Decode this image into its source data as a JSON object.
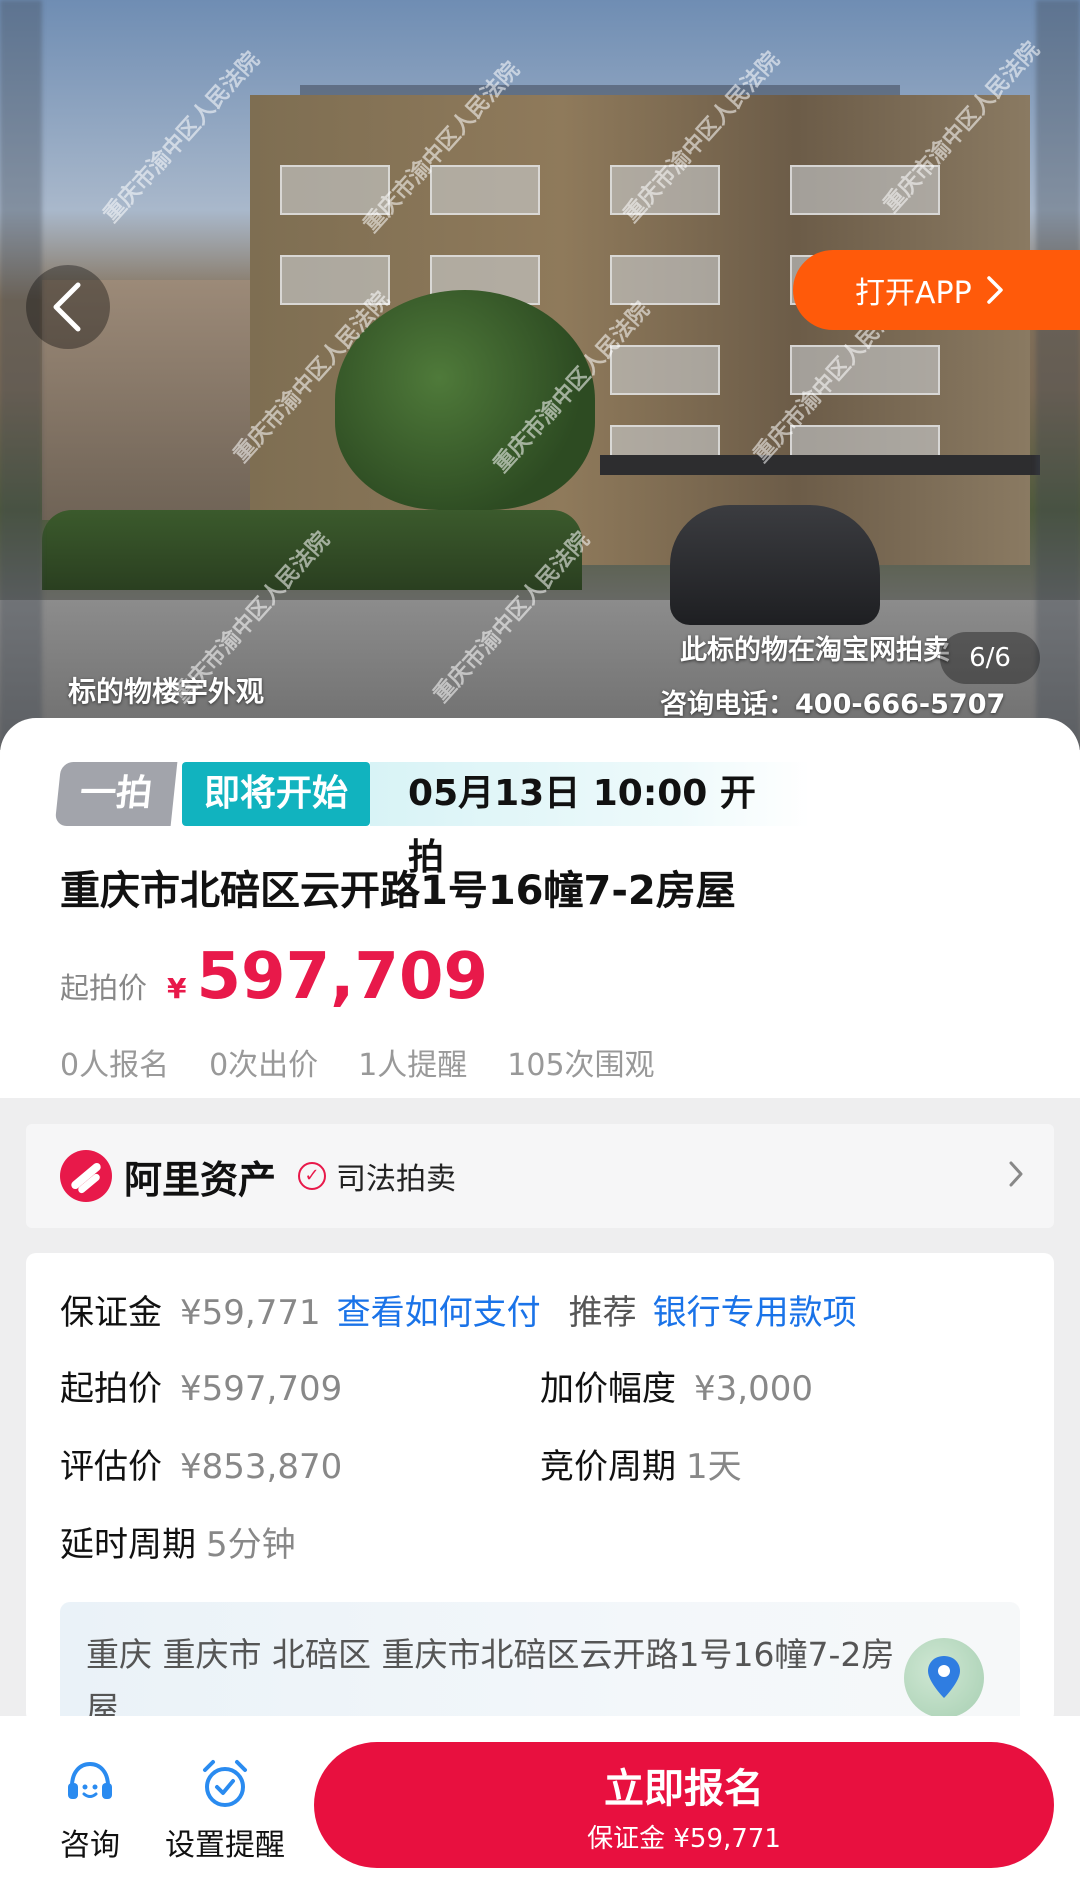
{
  "hero": {
    "caption": "标的物楼宇外观",
    "notice_line1": "此标的物在淘宝网拍卖",
    "notice_line2": "咨询电话：400-666-5707",
    "counter": "6/6",
    "watermark": "重庆市渝中区人民法院",
    "open_app_label": "打开APP"
  },
  "status": {
    "round": "一拍",
    "state": "即将开始",
    "start_time": "05月13日 10:00 开拍"
  },
  "title": "重庆市北碚区云开路1号16幢7-2房屋",
  "price": {
    "label": "起拍价",
    "currency": "¥",
    "value": "597,709"
  },
  "stats": {
    "signups": "0人报名",
    "bids": "0次出价",
    "reminders": "1人提醒",
    "views": "105次围观"
  },
  "asset_bar": {
    "brand": "阿里资产",
    "category": "司法拍卖"
  },
  "info": {
    "deposit_label": "保证金",
    "deposit_value": "¥59,771",
    "deposit_link": "查看如何支付",
    "recommend_label": "推荐",
    "recommend_link": "银行专用款项",
    "start_price_label": "起拍价",
    "start_price_value": "¥597,709",
    "increment_label": "加价幅度",
    "increment_value": "¥3,000",
    "appraisal_label": "评估价",
    "appraisal_value": "¥853,870",
    "bid_period_label": "竞价周期",
    "bid_period_value": "1天",
    "delay_label": "延时周期",
    "delay_value": "5分钟",
    "address": "重庆 重庆市 北碚区 重庆市北碚区云开路1号16幢7-2房屋"
  },
  "bottom": {
    "consult_label": "咨询",
    "reminder_label": "设置提醒",
    "signup_label": "立即报名",
    "signup_sub": "保证金 ¥59,771"
  },
  "colors": {
    "brand_red": "#e8194a",
    "teal": "#11b3bf",
    "orange": "#ff5a0a",
    "link_blue": "#1a73e8"
  }
}
